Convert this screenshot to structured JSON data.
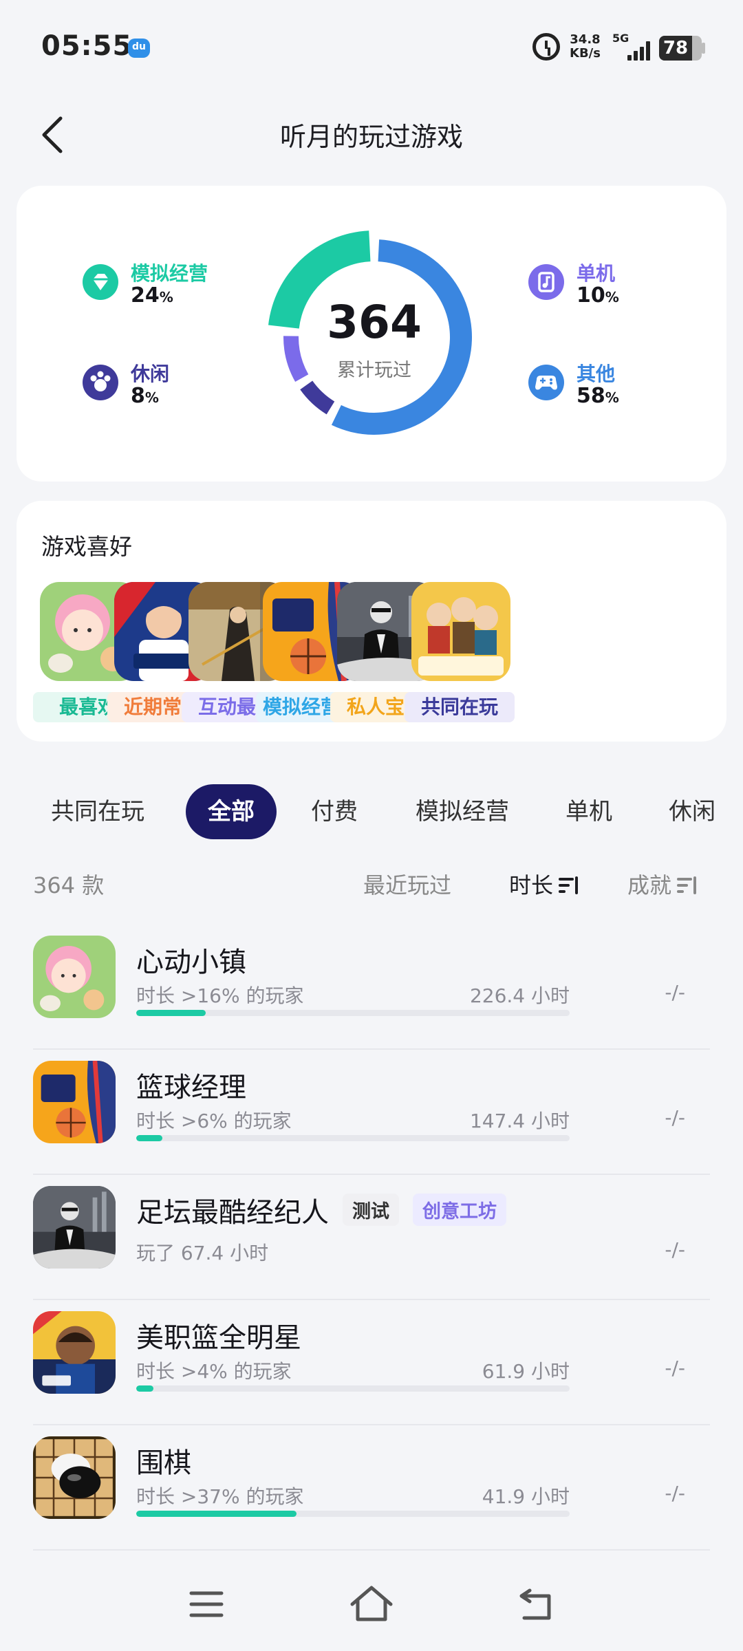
{
  "status_bar": {
    "time": "05:55",
    "net_speed_value": "34.8",
    "net_speed_unit": "KB/s",
    "network": "5G",
    "battery": "78",
    "battery_level": 0.78
  },
  "header": {
    "back_icon": "chevron-left-icon",
    "title": "听月的玩过游戏"
  },
  "stats": {
    "total_count": "364",
    "total_label": "累计玩过",
    "categories": [
      {
        "name": "模拟经营",
        "percent": "24",
        "unit": "%",
        "color": "#1ccaa4",
        "icon": "gem-icon"
      },
      {
        "name": "休闲",
        "percent": "8",
        "unit": "%",
        "color": "#3f3a9a",
        "icon": "paw-icon"
      },
      {
        "name": "单机",
        "percent": "10",
        "unit": "%",
        "color": "#7b6bea",
        "icon": "music-note-icon"
      },
      {
        "name": "其他",
        "percent": "58",
        "unit": "%",
        "color": "#3a86e0",
        "icon": "gamepad-icon"
      }
    ]
  },
  "preferences": {
    "title": "游戏喜好",
    "items": [
      {
        "label": "最喜欢",
        "label_color": "#19b993",
        "label_bg": "#e6f8f2"
      },
      {
        "label": "近期常玩",
        "label_color": "#f07c3a",
        "label_bg": "#fdeee4"
      },
      {
        "label": "互动最多",
        "label_color": "#7a6ce8",
        "label_bg": "#efecfd"
      },
      {
        "label": "模拟经营…",
        "label_color": "#2ea6e6",
        "label_bg": "#e6f4fc"
      },
      {
        "label": "私人宝藏",
        "label_color": "#f2a51b",
        "label_bg": "#fdf3e0"
      },
      {
        "label": "共同在玩",
        "label_color": "#3a3a9a",
        "label_bg": "#eceafa"
      }
    ]
  },
  "tabs": [
    "共同在玩",
    "全部",
    "付费",
    "模拟经营",
    "单机",
    "休闲"
  ],
  "active_tab": "全部",
  "list_header": {
    "count": "364 款",
    "sort_recent": "最近玩过",
    "sort_duration": "时长",
    "sort_achievement": "成就"
  },
  "games": [
    {
      "name": "心动小镇",
      "meta": "时长 >16% 的玩家",
      "hours": "226.4 小时",
      "progress": 0.16,
      "achievement": "-/-"
    },
    {
      "name": "篮球经理",
      "meta": "时长 >6% 的玩家",
      "hours": "147.4 小时",
      "progress": 0.06,
      "achievement": "-/-"
    },
    {
      "name": "足坛最酷经纪人",
      "tag1": "测试",
      "tag2": "创意工坊",
      "meta": "玩了 67.4 小时",
      "achievement": "-/-"
    },
    {
      "name": "美职篮全明星",
      "meta": "时长 >4% 的玩家",
      "hours": "61.9 小时",
      "progress": 0.04,
      "achievement": "-/-"
    },
    {
      "name": "围棋",
      "meta": "时长 >37% 的玩家",
      "hours": "41.9 小时",
      "progress": 0.37,
      "achievement": "-/-"
    }
  ],
  "nav": {
    "menu_icon": "menu-icon",
    "home_icon": "home-icon",
    "back_icon": "back-arrow-icon"
  }
}
